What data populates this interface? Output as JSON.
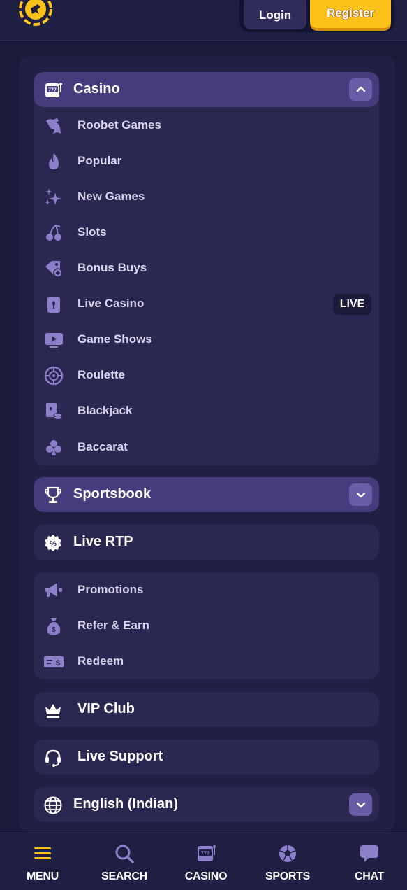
{
  "header": {
    "login_label": "Login",
    "register_label": "Register",
    "brand_color": "#fcc21a"
  },
  "casino": {
    "title": "Casino",
    "items": [
      {
        "label": "Roobet Games",
        "icon": "kangaroo-icon"
      },
      {
        "label": "Popular",
        "icon": "flame-icon"
      },
      {
        "label": "New Games",
        "icon": "sparkle-icon"
      },
      {
        "label": "Slots",
        "icon": "cherries-icon"
      },
      {
        "label": "Bonus Buys",
        "icon": "tag-plus-icon"
      },
      {
        "label": "Live Casino",
        "icon": "card-icon",
        "badge": "LIVE"
      },
      {
        "label": "Game Shows",
        "icon": "tv-icon"
      },
      {
        "label": "Roulette",
        "icon": "roulette-icon"
      },
      {
        "label": "Blackjack",
        "icon": "card-chips-icon"
      },
      {
        "label": "Baccarat",
        "icon": "club-icon"
      }
    ]
  },
  "sportsbook": {
    "title": "Sportsbook"
  },
  "live_rtp": {
    "title": "Live RTP"
  },
  "extras": {
    "items": [
      {
        "label": "Promotions",
        "icon": "megaphone-icon"
      },
      {
        "label": "Refer & Earn",
        "icon": "money-bag-icon"
      },
      {
        "label": "Redeem",
        "icon": "voucher-icon"
      }
    ]
  },
  "vip": {
    "title": "VIP Club"
  },
  "support": {
    "title": "Live Support"
  },
  "language": {
    "title": "English (Indian)"
  },
  "bottom_nav": [
    {
      "label": "MENU",
      "icon": "hamburger-icon"
    },
    {
      "label": "SEARCH",
      "icon": "search-icon"
    },
    {
      "label": "CASINO",
      "icon": "slot-machine-icon"
    },
    {
      "label": "SPORTS",
      "icon": "soccer-ball-icon"
    },
    {
      "label": "CHAT",
      "icon": "chat-bubble-icon"
    }
  ]
}
